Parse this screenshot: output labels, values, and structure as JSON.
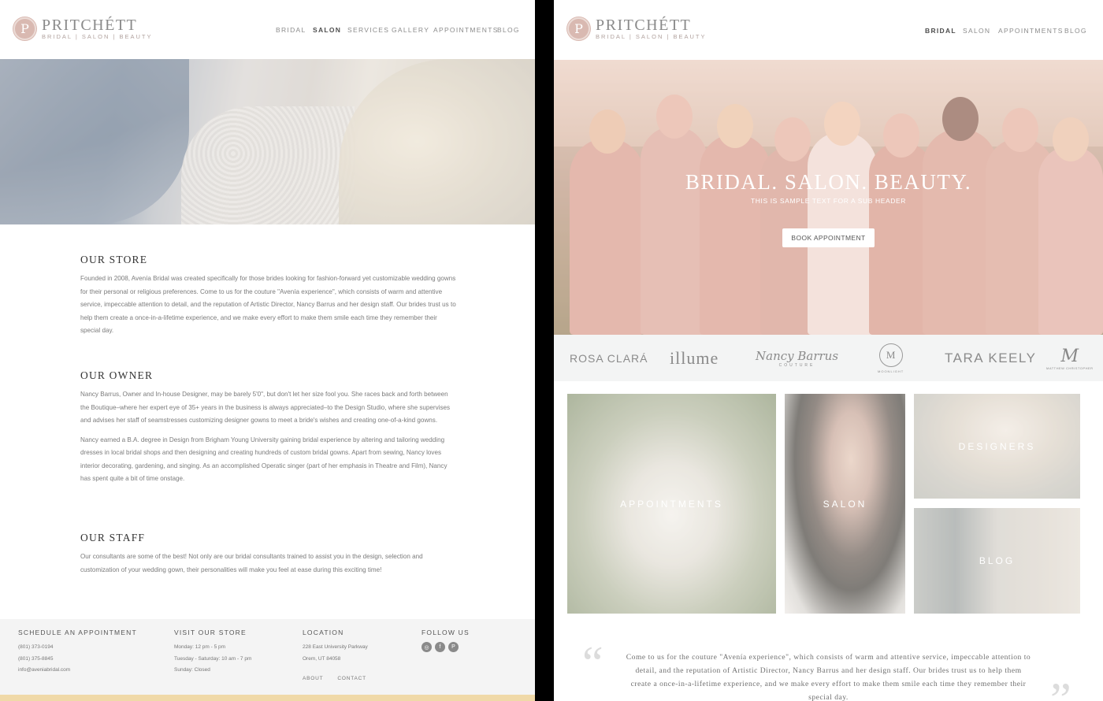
{
  "left_page": {
    "logo": {
      "initial": "P",
      "name": "PRITCHÉTT",
      "tagline": "BRIDAL | SALON | BEAUTY"
    },
    "nav": [
      "BRIDAL",
      "SALON",
      "SERVICES",
      "GALLERY",
      "APPOINTMENTS",
      "BLOG"
    ],
    "active_nav": "SALON",
    "sections": [
      {
        "title": "OUR STORE",
        "paragraphs": [
          "Founded in 2008, Avenía Bridal was created specifically for those brides looking for fashion-forward yet customizable wedding gowns for their personal or religious preferences. Come to us for the couture \"Avenía experience\", which consists of warm and attentive service, impeccable attention to detail, and the reputation of Artistic Director, Nancy Barrus and her design staff. Our brides trust us to help them create a once-in-a-lifetime experience, and we make every effort to make them smile each time they remember their special day."
        ]
      },
      {
        "title": "OUR OWNER",
        "paragraphs": [
          "Nancy Barrus, Owner and In-house Designer, may be barely 5'0\", but don't let her size fool you. She races back and forth between the Boutique–where her expert eye of 35+ years in the business is always appreciated–to the Design Studio, where she supervises and advises her staff of seamstresses customizing designer gowns to meet a bride's wishes and creating one-of-a-kind gowns.",
          "Nancy earned a B.A. degree in Design from Brigham Young University gaining bridal experience by altering and tailoring wedding dresses in local bridal shops and then designing and creating hundreds of custom bridal gowns. Apart from sewing, Nancy loves interior decorating, gardening, and singing. As an accomplished Operatic singer (part of her emphasis in Theatre and Film), Nancy has spent quite a bit of time onstage."
        ]
      },
      {
        "title": "OUR STAFF",
        "paragraphs": [
          "Our consultants are some of the best! Not only are our bridal consultants trained to assist you in the design, selection and customization of your wedding gown, their personalities will make you feel at ease during this exciting time!"
        ]
      }
    ],
    "footer": {
      "schedule": {
        "heading": "SCHEDULE AN APPOINTMENT",
        "lines": [
          "(801) 373-0194",
          "(801) 375-8845",
          "info@aveniabridal.com"
        ]
      },
      "visit": {
        "heading": "VISIT OUR STORE",
        "lines": [
          "Monday: 12 pm - 5 pm",
          "Tuesday - Saturday: 10 am - 7 pm",
          "Sunday: Closed"
        ]
      },
      "location": {
        "heading": "LOCATION",
        "lines": [
          "228 East University Parkway",
          "Orem, UT 84058"
        ]
      },
      "follow": {
        "heading": "FOLLOW US",
        "icons": [
          "instagram-icon",
          "facebook-icon",
          "pinterest-icon"
        ],
        "glyphs": [
          "◎",
          "f",
          "P"
        ]
      },
      "links": [
        "ABOUT",
        "CONTACT"
      ]
    }
  },
  "right_page": {
    "logo": {
      "initial": "P",
      "name": "PRITCHÉTT",
      "tagline": "BRIDAL | SALON | BEAUTY"
    },
    "nav": [
      "BRIDAL",
      "SALON",
      "APPOINTMENTS",
      "BLOG"
    ],
    "active_nav": "BRIDAL",
    "hero": {
      "title": "BRIDAL. SALON. BEAUTY.",
      "subtitle": "THIS IS SAMPLE TEXT FOR A SUB HEADER",
      "button": "BOOK APPOINTMENT"
    },
    "brands": {
      "rosa": "ROSA CLARÁ",
      "illume": "illume",
      "nancy": "Nancy Barrus",
      "nancy_sub": "COUTURE",
      "moon_initial": "M",
      "moon_sub": "MOONLIGHT",
      "tara": "TARA KEELY",
      "matt_mark": "M",
      "matt_sub": "MATTHEW CHRISTOPHER"
    },
    "tiles": [
      "APPOINTMENTS",
      "SALON",
      "DESIGNERS",
      "BLOG"
    ],
    "quote": "Come to us for the couture \"Avenía experience\", which consists of warm and attentive service, impeccable attention to detail, and the reputation of Artistic Director, Nancy Barrus and her design staff. Our brides trust us to help them create a once-in-a-lifetime experience, and we make every effort to make them smile each time they remember their special day.",
    "quote_open": "“",
    "quote_close": "”"
  },
  "colors": {
    "logo_rose": "#d9b9b1",
    "footer_bg": "#f4f4f4",
    "footer_strip": "#f0d9a8",
    "divider": "#000000"
  }
}
